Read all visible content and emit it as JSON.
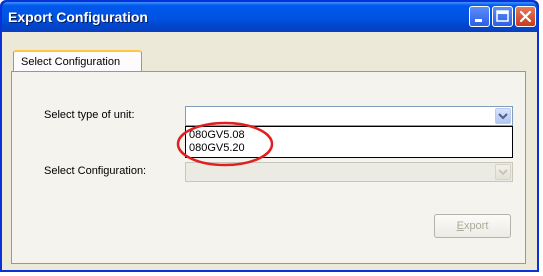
{
  "window": {
    "title": "Export Configuration",
    "controls": {
      "minimize": "minimize-icon",
      "maximize": "maximize-icon",
      "close": "close-icon"
    }
  },
  "tabs": [
    {
      "label": "Select Configuration",
      "active": true
    }
  ],
  "form": {
    "unit_type_label": "Select type of unit:",
    "unit_type_value": "",
    "unit_type_options": [
      "080GV5.08",
      "080GV5.20"
    ],
    "configuration_label": "Select Configuration:",
    "configuration_value": "",
    "export_prefix": "",
    "export_mnemonic": "E",
    "export_rest": "xport"
  },
  "colors": {
    "title_bar": "#0054e3",
    "highlight_ellipse": "#e02020",
    "tab_accent": "#ffc83c"
  }
}
